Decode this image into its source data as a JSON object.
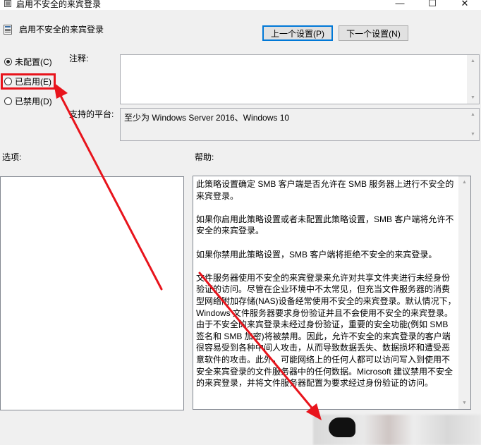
{
  "window": {
    "title": "启用不安全的来宾登录",
    "controls": {
      "minimize": "—",
      "maximize": "☐",
      "close": "✕"
    }
  },
  "header": {
    "policy_title": "启用不安全的来宾登录",
    "prev_button": "上一个设置(P)",
    "next_button": "下一个设置(N)"
  },
  "state": {
    "options": [
      {
        "label": "未配置(C)",
        "checked": true
      },
      {
        "label": "已启用(E)",
        "checked": false
      },
      {
        "label": "已禁用(D)",
        "checked": false
      }
    ],
    "highlighted_option": "已启用(E)"
  },
  "comment": {
    "label": "注释:",
    "value": ""
  },
  "platform": {
    "label": "支持的平台:",
    "value": "至少为 Windows Server 2016、Windows 10"
  },
  "sections": {
    "options_label": "选项:",
    "help_label": "帮助:"
  },
  "help": {
    "paragraphs": [
      "此策略设置确定 SMB 客户端是否允许在 SMB 服务器上进行不安全的来宾登录。",
      "如果你启用此策略设置或者未配置此策略设置，SMB 客户端将允许不安全的来宾登录。",
      "如果你禁用此策略设置，SMB 客户端将拒绝不安全的来宾登录。",
      "文件服务器使用不安全的来宾登录来允许对共享文件夹进行未经身份验证的访问。尽管在企业环境中不太常见，但充当文件服务器的消费型网络附加存储(NAS)设备经常使用不安全的来宾登录。默认情况下，Windows 文件服务器要求身份验证并且不会使用不安全的来宾登录。由于不安全的来宾登录未经过身份验证，重要的安全功能(例如 SMB 签名和 SMB 加密)将被禁用。因此，允许不安全的来宾登录的客户端很容易受到各种中间人攻击，从而导致数据丢失、数据损坏和遭受恶意软件的攻击。此外，可能网络上的任何人都可以访问写入到使用不安全来宾登录的文件服务器中的任何数据。Microsoft 建议禁用不安全的来宾登录，并将文件服务器配置为要求经过身份验证的访问。"
    ]
  },
  "colors": {
    "annotation_red": "#e8141c",
    "focus_blue": "#0078d7"
  },
  "icons": {
    "title": "policy-setting-icon",
    "header": "policy-setting-icon"
  }
}
